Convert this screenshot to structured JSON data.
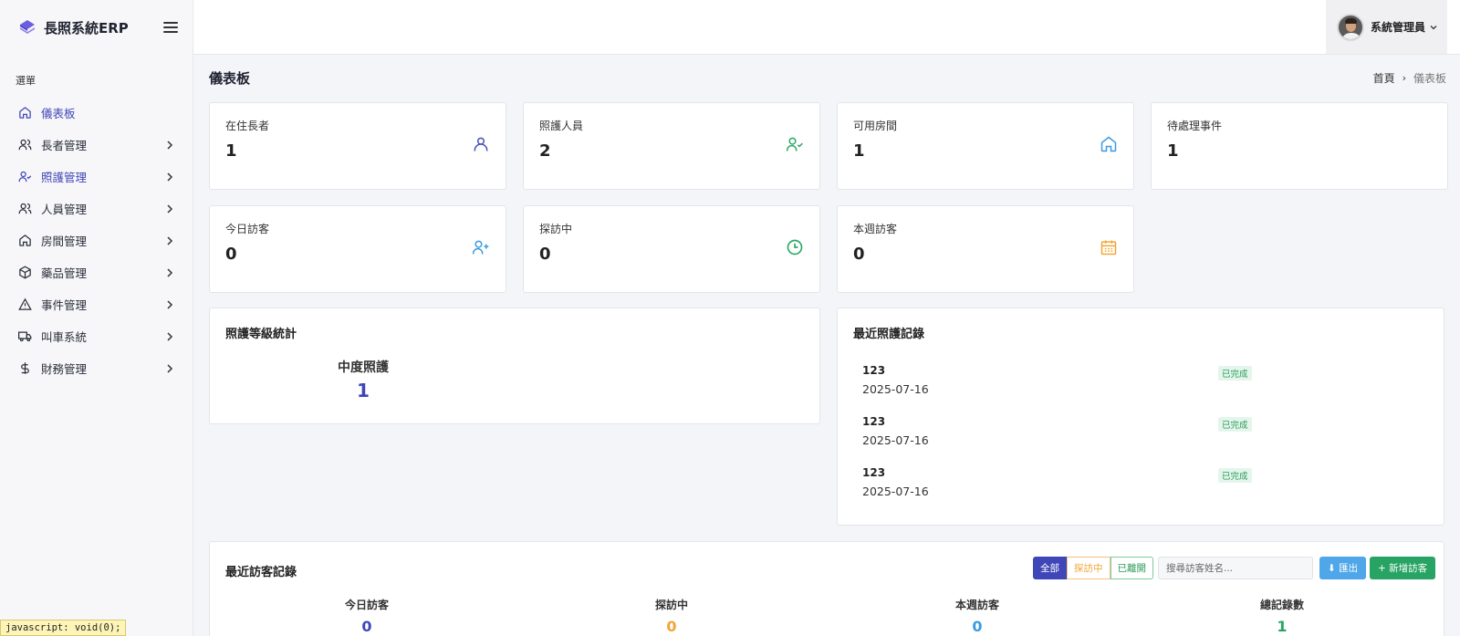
{
  "app": {
    "brand": "長照系統ERP"
  },
  "sidebar": {
    "heading": "選單",
    "items": [
      {
        "label": "儀表板",
        "icon": "home-icon",
        "active": true
      },
      {
        "label": "長者管理",
        "icon": "users-icon"
      },
      {
        "label": "照護管理",
        "icon": "user-check-icon"
      },
      {
        "label": "人員管理",
        "icon": "users-icon"
      },
      {
        "label": "房間管理",
        "icon": "home-icon"
      },
      {
        "label": "藥品管理",
        "icon": "package-icon"
      },
      {
        "label": "事件管理",
        "icon": "alert-triangle-icon"
      },
      {
        "label": "叫車系統",
        "icon": "truck-icon"
      },
      {
        "label": "財務管理",
        "icon": "dollar-icon"
      }
    ]
  },
  "status_tip": "javascript: void(0);",
  "topbar": {
    "user_name": "系統管理員"
  },
  "page": {
    "title": "儀表板",
    "breadcrumb": {
      "home": "首頁",
      "separator": "›",
      "current": "儀表板"
    }
  },
  "stats": [
    {
      "label": "在住長者",
      "value": "1",
      "icon": "user-icon",
      "color": "#4a51b8"
    },
    {
      "label": "照護人員",
      "value": "2",
      "icon": "user-check-icon",
      "color": "#2ea866"
    },
    {
      "label": "可用房間",
      "value": "1",
      "icon": "home-icon",
      "color": "#3b9ae0"
    },
    {
      "label": "待處理事件",
      "value": "1",
      "icon": "",
      "color": ""
    },
    {
      "label": "今日訪客",
      "value": "0",
      "icon": "user-plus-icon",
      "color": "#3b9ae0"
    },
    {
      "label": "探訪中",
      "value": "0",
      "icon": "clock-icon",
      "color": "#2ea866"
    },
    {
      "label": "本週訪客",
      "value": "0",
      "icon": "calendar-icon",
      "color": "#f0a637"
    }
  ],
  "care_levels": {
    "title": "照護等級統計",
    "items": [
      {
        "name": "中度照護",
        "count": "1"
      }
    ]
  },
  "recent_care": {
    "title": "最近照護記錄",
    "records": [
      {
        "name": "123",
        "date": "2025-07-16",
        "status": "已完成"
      },
      {
        "name": "123",
        "date": "2025-07-16",
        "status": "已完成"
      },
      {
        "name": "123",
        "date": "2025-07-16",
        "status": "已完成"
      }
    ]
  },
  "visitors": {
    "title": "最近訪客記錄",
    "filters": {
      "all": "全部",
      "visiting": "探訪中",
      "left": "已離開"
    },
    "search_placeholder": "搜尋訪客姓名...",
    "export_label": "⬇ 匯出",
    "add_label": "+ 新增訪客",
    "stats": [
      {
        "label": "今日訪客",
        "value": "0",
        "color": "#3f46b8"
      },
      {
        "label": "探訪中",
        "value": "0",
        "color": "#f0a637"
      },
      {
        "label": "本週訪客",
        "value": "0",
        "color": "#3b9ae0"
      },
      {
        "label": "總記錄數",
        "value": "1",
        "color": "#27a463"
      }
    ]
  },
  "colors": {
    "accent": "#3f46b8",
    "success": "#27a463",
    "info": "#4fa6e8",
    "warning": "#f0a637"
  }
}
